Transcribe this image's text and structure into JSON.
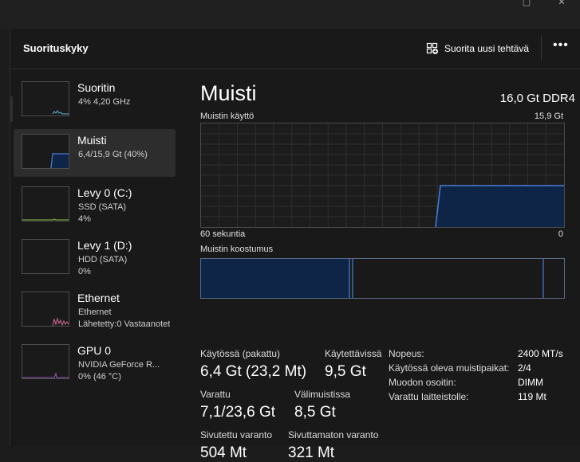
{
  "header": {
    "title": "Suorituskyky",
    "run_task_label": "Suorita uusi tehtävä",
    "more_label": "•••"
  },
  "window": {
    "maximize_glyph": "▢",
    "close_glyph": "✕"
  },
  "sidebar": {
    "items": [
      {
        "title": "Suoritin",
        "line1": "4%  4,20 GHz",
        "line2": "",
        "icon": "cpu-graph"
      },
      {
        "title": "Muisti",
        "line1": "6,4/15,9 Gt (40%)",
        "line2": "",
        "icon": "memory-graph"
      },
      {
        "title": "Levy 0 (C:)",
        "line1": "SSD (SATA)",
        "line2": "4%",
        "icon": "disk-graph"
      },
      {
        "title": "Levy 1 (D:)",
        "line1": "HDD (SATA)",
        "line2": "0%",
        "icon": "disk-graph"
      },
      {
        "title": "Ethernet",
        "line1": "Ethernet",
        "line2": "Lähetetty:0 Vastaanotet",
        "icon": "network-graph"
      },
      {
        "title": "GPU 0",
        "line1": "NVIDIA GeForce R...",
        "line2": "0%  (46 °C)",
        "icon": "gpu-graph"
      }
    ]
  },
  "main": {
    "title": "Muisti",
    "spec": "16,0 Gt DDR4",
    "usage_label": "Muistin käyttö",
    "usage_max": "15,9 Gt",
    "time_label": "60 sekuntia",
    "time_end": "0",
    "usage_fraction": 0.4,
    "composition_label": "Muistin koostumus",
    "stats": {
      "in_use_label": "Käytössä (pakattu)",
      "in_use_value": "6,4 Gt (23,2 Mt)",
      "available_label": "Käytettävissä",
      "available_value": "9,5 Gt",
      "committed_label": "Varattu",
      "committed_value": "7,1/23,6 Gt",
      "cached_label": "Välimuistissa",
      "cached_value": "8,5 Gt",
      "paged_label": "Sivutettu varanto",
      "paged_value": "504 Mt",
      "nonpaged_label": "Sivuttamaton varanto",
      "nonpaged_value": "321 Mt"
    },
    "details": [
      {
        "label": "Nopeus:",
        "value": "2400 MT/s"
      },
      {
        "label": "Käytössä oleva muistipaikat:",
        "value": "2/4"
      },
      {
        "label": "Muodon osoitin:",
        "value": "DIMM"
      },
      {
        "label": "Varattu laitteistolle:",
        "value": "119 Mt"
      }
    ]
  },
  "colors": {
    "accent": "#4a7fd4",
    "fill": "#0f2547",
    "bg": "#191919",
    "network": "#d36a9a",
    "gpu": "#9b59b6"
  }
}
